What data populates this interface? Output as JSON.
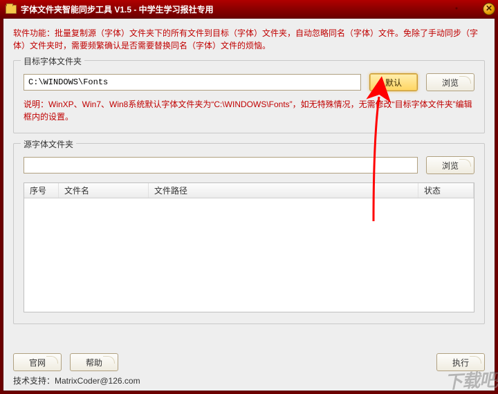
{
  "title": "字体文件夹智能同步工具 V1.5 - 中学生学习报社专用",
  "description": "软件功能：批量复制源（字体）文件夹下的所有文件到目标（字体）文件夹，自动忽略同名（字体）文件。免除了手动同步（字体）文件夹时，需要频繁确认是否需要替换同名（字体）文件的烦恼。",
  "group_target": {
    "title": "目标字体文件夹",
    "path": "C:\\WINDOWS\\Fonts",
    "default_btn": "默认",
    "browse_btn": "浏览",
    "note": "说明：WinXP、Win7、Win8系统默认字体文件夹为“C:\\WINDOWS\\Fonts”，如无特殊情况，无需修改“目标字体文件夹”编辑框内的设置。"
  },
  "group_source": {
    "title": "源字体文件夹",
    "path": "",
    "browse_btn": "浏览",
    "columns": {
      "idx": "序号",
      "name": "文件名",
      "path": "文件路径",
      "status": "状态"
    }
  },
  "bottom": {
    "website": "官网",
    "help": "帮助",
    "run": "执行"
  },
  "tech_support_label": "技术支持：",
  "tech_support_value": "MatrixCoder@126.com",
  "watermark": "下载吧",
  "colors": {
    "accent": "#c00000",
    "frame": "#6b0000",
    "highlight": "#ffd560"
  }
}
